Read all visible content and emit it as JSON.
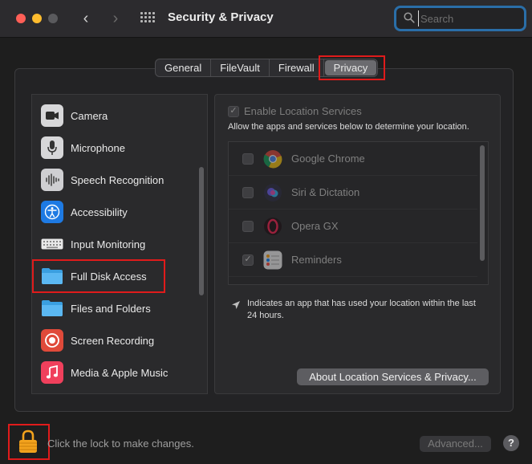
{
  "window": {
    "title": "Security & Privacy",
    "search_placeholder": "Search"
  },
  "tabs": [
    {
      "label": "General"
    },
    {
      "label": "FileVault"
    },
    {
      "label": "Firewall"
    },
    {
      "label": "Privacy",
      "selected": true
    }
  ],
  "sidebar": {
    "items": [
      {
        "label": "Camera",
        "icon": "camera-icon"
      },
      {
        "label": "Microphone",
        "icon": "microphone-icon"
      },
      {
        "label": "Speech Recognition",
        "icon": "waveform-icon"
      },
      {
        "label": "Accessibility",
        "icon": "accessibility-icon"
      },
      {
        "label": "Input Monitoring",
        "icon": "keyboard-icon"
      },
      {
        "label": "Full Disk Access",
        "icon": "folder-icon"
      },
      {
        "label": "Files and Folders",
        "icon": "folder-icon"
      },
      {
        "label": "Screen Recording",
        "icon": "record-icon"
      },
      {
        "label": "Media & Apple Music",
        "icon": "music-icon"
      }
    ]
  },
  "location": {
    "enable_label": "Enable Location Services",
    "enable_checked": true,
    "description": "Allow the apps and services below to determine your location.",
    "apps": [
      {
        "name": "Google Chrome",
        "checked": false,
        "icon": "chrome-icon"
      },
      {
        "name": "Siri & Dictation",
        "checked": false,
        "icon": "siri-icon"
      },
      {
        "name": "Opera GX",
        "checked": false,
        "icon": "opera-icon"
      },
      {
        "name": "Reminders",
        "checked": true,
        "icon": "reminders-icon"
      }
    ],
    "note": "Indicates an app that has used your location within the last 24 hours.",
    "about_button": "About Location Services & Privacy..."
  },
  "footer": {
    "lock_text": "Click the lock to make changes.",
    "advanced_button": "Advanced...",
    "help_label": "?"
  },
  "colors": {
    "accent_blue": "#2a6ea8",
    "highlight_red": "#e01b1b",
    "lock_orange": "#f2a21d"
  }
}
